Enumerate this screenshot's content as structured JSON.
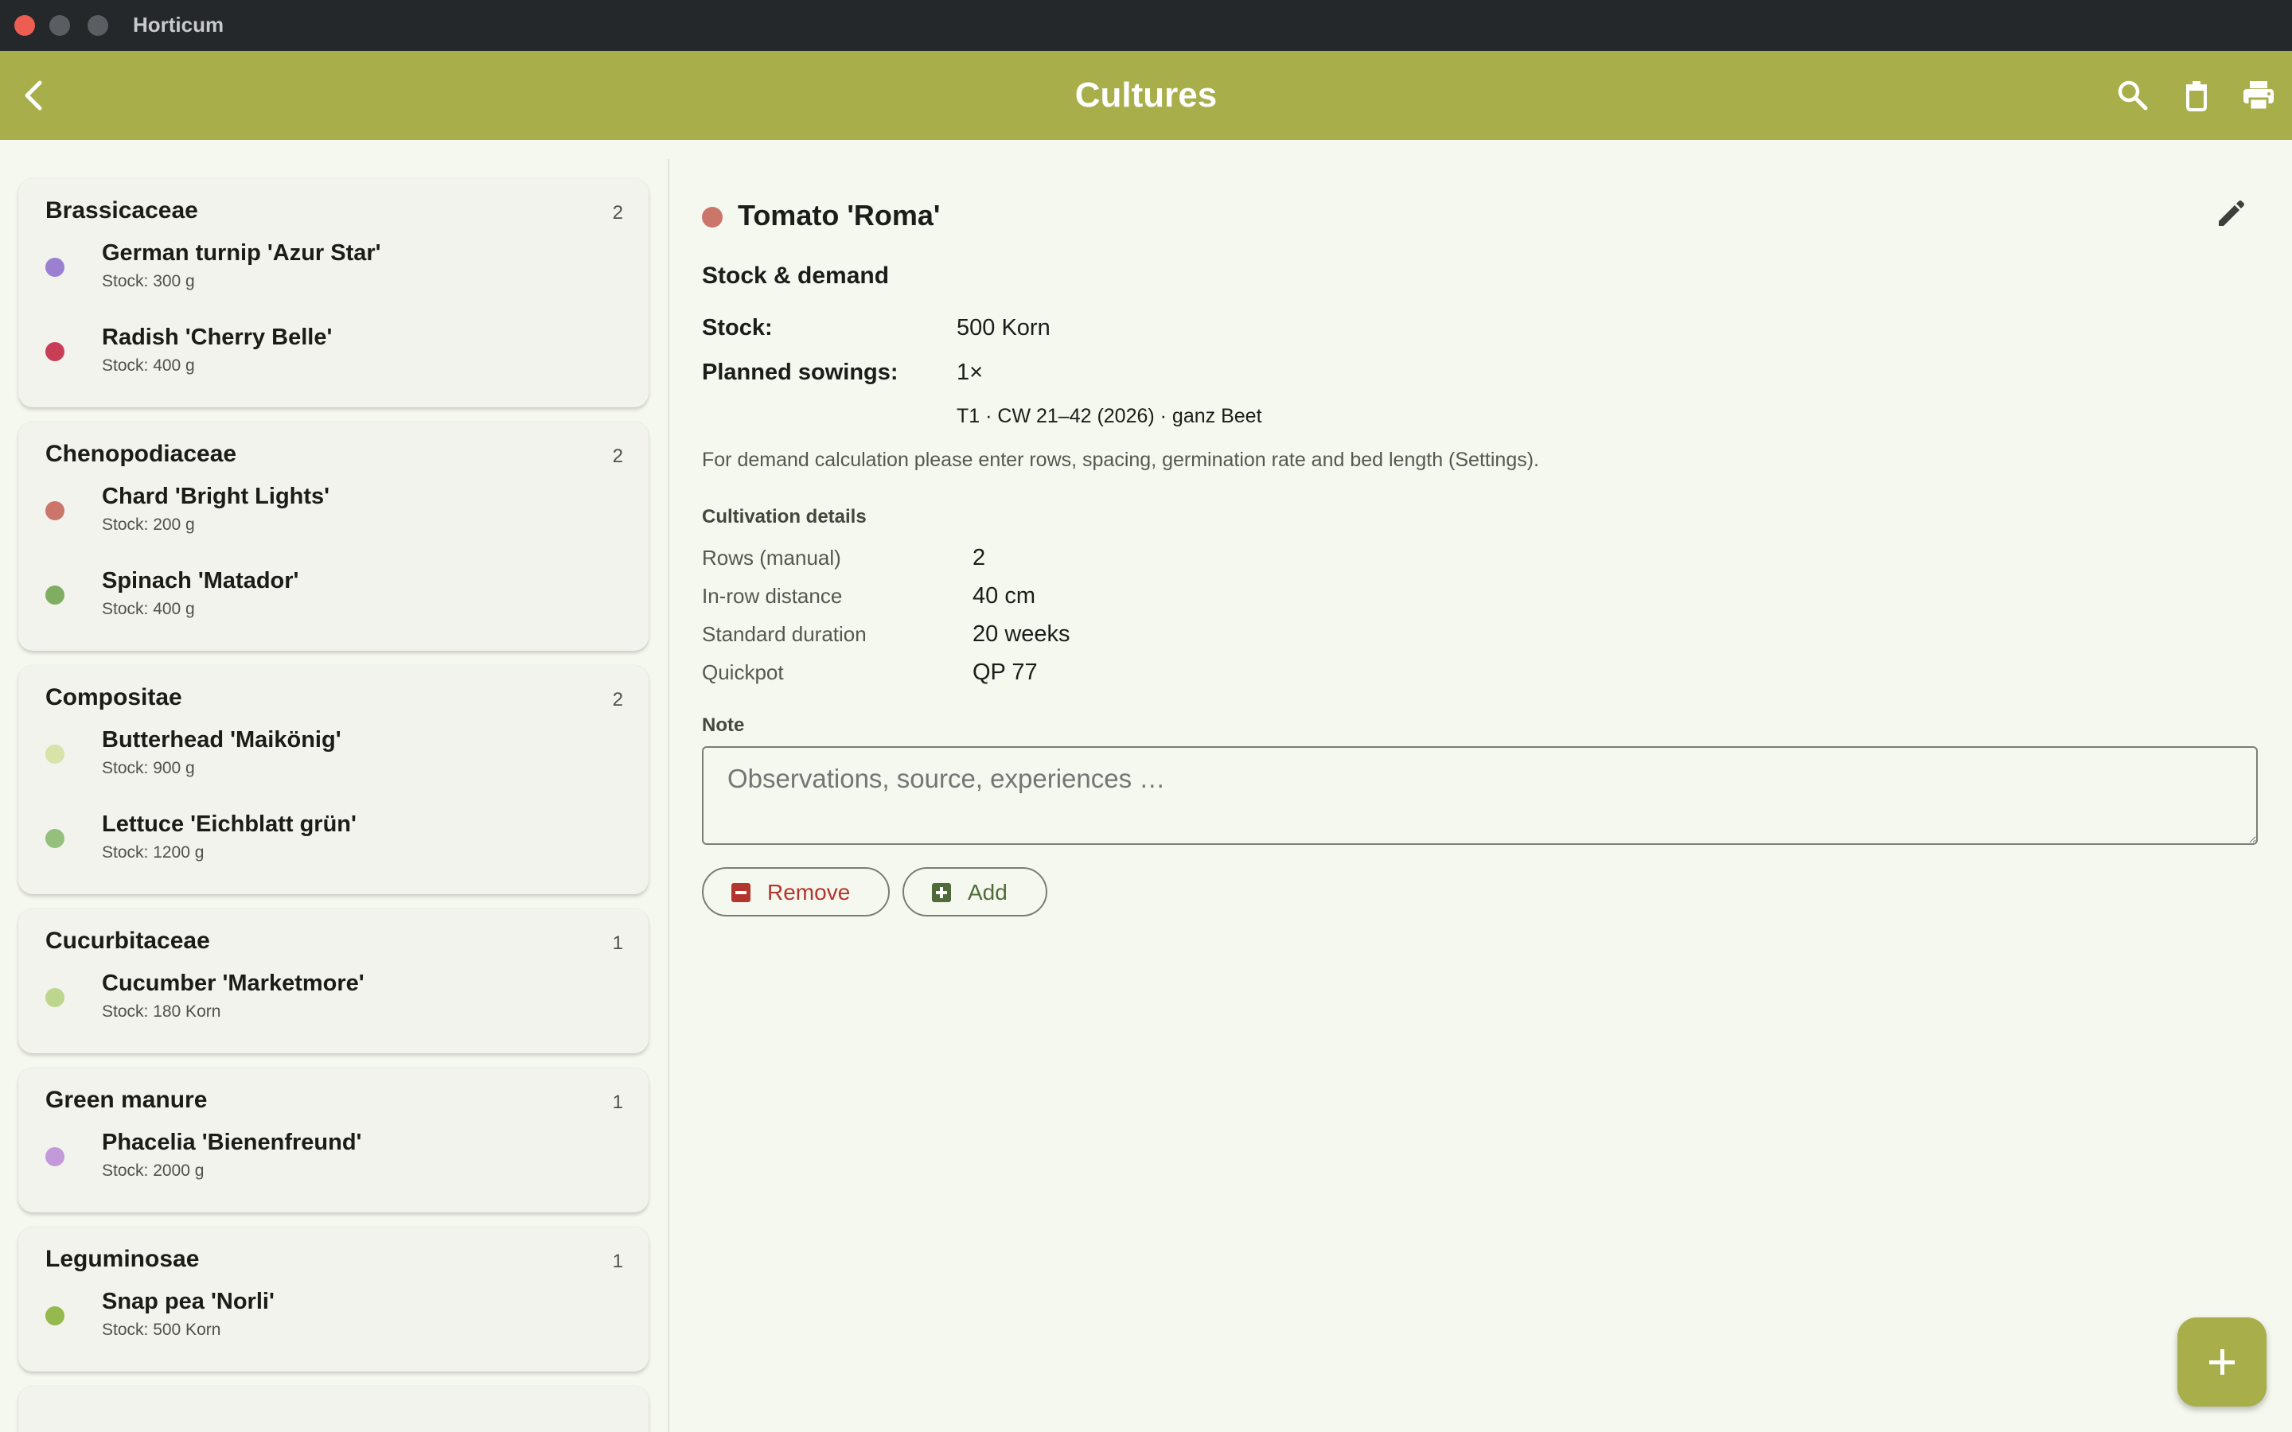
{
  "window": {
    "app_title": "Horticum"
  },
  "appbar": {
    "title": "Cultures"
  },
  "families": [
    {
      "name": "Brassicaceae",
      "count": "2",
      "items": [
        {
          "name": "German turnip 'Azur Star'",
          "stock": "Stock: 300 g",
          "color": "#9b7fd0"
        },
        {
          "name": "Radish 'Cherry Belle'",
          "stock": "Stock: 400 g",
          "color": "#c93e57"
        }
      ]
    },
    {
      "name": "Chenopodiaceae",
      "count": "2",
      "items": [
        {
          "name": "Chard 'Bright Lights'",
          "stock": "Stock: 200 g",
          "color": "#cb756b"
        },
        {
          "name": "Spinach 'Matador'",
          "stock": "Stock: 400 g",
          "color": "#7fae63"
        }
      ]
    },
    {
      "name": "Compositae",
      "count": "2",
      "items": [
        {
          "name": "Butterhead 'Maikönig'",
          "stock": "Stock: 900 g",
          "color": "#d7e3a8"
        },
        {
          "name": "Lettuce 'Eichblatt grün'",
          "stock": "Stock: 1200 g",
          "color": "#95bf7c"
        }
      ]
    },
    {
      "name": "Cucurbitaceae",
      "count": "1",
      "items": [
        {
          "name": "Cucumber 'Marketmore'",
          "stock": "Stock: 180 Korn",
          "color": "#bcd68e"
        }
      ]
    },
    {
      "name": "Green manure",
      "count": "1",
      "items": [
        {
          "name": "Phacelia 'Bienenfreund'",
          "stock": "Stock: 2000 g",
          "color": "#c39ad9"
        }
      ]
    },
    {
      "name": "Leguminosae",
      "count": "1",
      "items": [
        {
          "name": "Snap pea 'Norli'",
          "stock": "Stock: 500 Korn",
          "color": "#96b94e"
        }
      ]
    }
  ],
  "detail": {
    "title": "Tomato 'Roma'",
    "dot_color": "#cb756b",
    "section_title": "Stock & demand",
    "stock_label": "Stock:",
    "stock_value": "500 Korn",
    "planned_label": "Planned sowings:",
    "planned_value": "1×",
    "planned_detail": "T1 · CW 21–42 (2026) · ganz Beet",
    "hint": "For demand calculation please enter rows, spacing, germination rate and bed length (Settings).",
    "cultivation_title": "Cultivation details",
    "cultivation": [
      {
        "label": "Rows (manual)",
        "value": "2"
      },
      {
        "label": "In-row distance",
        "value": "40 cm"
      },
      {
        "label": "Standard duration",
        "value": "20 weeks"
      },
      {
        "label": "Quickpot",
        "value": "QP 77"
      }
    ],
    "note_label": "Note",
    "note_placeholder": "Observations, source, experiences …",
    "remove_label": "Remove",
    "add_label": "Add"
  },
  "colors": {
    "accent": "#a8ae49",
    "remove": "#b3352e",
    "add": "#4f6b3a"
  },
  "icons": [
    "back-arrow-icon",
    "search-icon",
    "trash-icon",
    "print-icon",
    "edit-pencil-icon",
    "minus-box-icon",
    "plus-box-icon",
    "plus-icon"
  ]
}
